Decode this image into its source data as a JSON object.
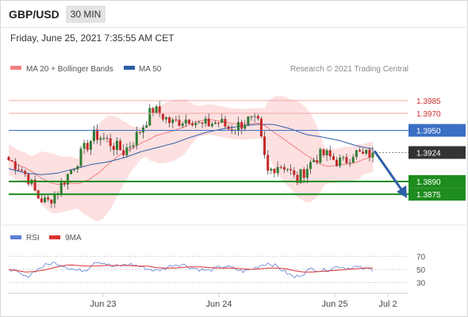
{
  "header": {
    "symbol": "GBP/USD",
    "timeframe": "30 MIN",
    "datetime": "Friday, June 25, 2021 7:35:55 AM CET"
  },
  "legend": {
    "bollinger": "MA 20 + Bollinger Bands",
    "ma50": "MA 50",
    "credit": "Research © 2021 Trading Central",
    "rsi": "RSI",
    "rsi_ma": "9MA"
  },
  "colors": {
    "candle_up": "#2e7d32",
    "candle_down": "#c62828",
    "bollinger_fill": "#fde0e0",
    "ma20": "#f08080",
    "ma50": "#2e5ea8",
    "resistance": "#f4a6a6",
    "pivot": "#3a6fc4",
    "support": "#1e8c1e",
    "current": "#333333",
    "arrow": "#2e5ea8",
    "rsi": "#5b7fd6",
    "rsi_ma": "#e03030"
  },
  "chart_data": [
    {
      "type": "line",
      "title": "GBP/USD",
      "x_ticks": [
        "Jun 23",
        "Jun 24",
        "Jun 25",
        "Jul 2"
      ],
      "ylim": [
        1.385,
        1.401
      ],
      "levels": [
        {
          "value": 1.3985,
          "label": "1.3985",
          "kind": "resistance"
        },
        {
          "value": 1.397,
          "label": "1.3970",
          "kind": "resistance"
        },
        {
          "value": 1.395,
          "label": "1.3950",
          "kind": "pivot"
        },
        {
          "value": 1.3924,
          "label": "1.3924",
          "kind": "current"
        },
        {
          "value": 1.389,
          "label": "1.3890",
          "kind": "support"
        },
        {
          "value": 1.3875,
          "label": "1.3875",
          "kind": "support"
        }
      ],
      "price_path": [
        1.3915,
        1.3908,
        1.3895,
        1.3872,
        1.3865,
        1.3878,
        1.3895,
        1.3912,
        1.393,
        1.3945,
        1.394,
        1.3932,
        1.3925,
        1.3938,
        1.3955,
        1.3975,
        1.3968,
        1.3958,
        1.3962,
        1.3965,
        1.3955,
        1.3958,
        1.396,
        1.3952,
        1.3956,
        1.3962,
        1.3958,
        1.39,
        1.391,
        1.3908,
        1.389,
        1.3905,
        1.3918,
        1.3922,
        1.3915,
        1.3912,
        1.3925,
        1.392,
        1.3924
      ],
      "ma50_path": [
        1.3905,
        1.39,
        1.3898,
        1.39,
        1.3905,
        1.391,
        1.3913,
        1.3918,
        1.3925,
        1.393,
        1.3935,
        1.3942,
        1.3948,
        1.3952,
        1.3955,
        1.3957,
        1.3957,
        1.3952,
        1.3945,
        1.3942,
        1.3938,
        1.3932,
        1.3928
      ]
    },
    {
      "type": "line",
      "title": "RSI",
      "ylim": [
        20,
        80
      ],
      "y_ticks": [
        70,
        50,
        30
      ],
      "series": [
        {
          "name": "RSI",
          "values": [
            52,
            45,
            38,
            48,
            55,
            60,
            58,
            52,
            48,
            50,
            63,
            60,
            54,
            56,
            58,
            55,
            51,
            48,
            52,
            57,
            58,
            53,
            50,
            48,
            52,
            55,
            51,
            47,
            50,
            56,
            60,
            54,
            45,
            38,
            44,
            52,
            48,
            50,
            55,
            52,
            54,
            51,
            50
          ]
        },
        {
          "name": "9MA",
          "values": [
            50,
            48,
            46,
            47,
            49,
            52,
            55,
            57,
            56,
            55,
            55,
            56,
            56,
            56,
            56,
            55,
            55,
            53,
            52,
            52,
            53,
            54,
            54,
            53,
            52,
            52,
            52,
            51,
            50,
            51,
            52,
            52,
            51,
            48,
            46,
            46,
            47,
            48,
            49,
            50,
            51,
            52,
            52
          ]
        }
      ]
    }
  ]
}
